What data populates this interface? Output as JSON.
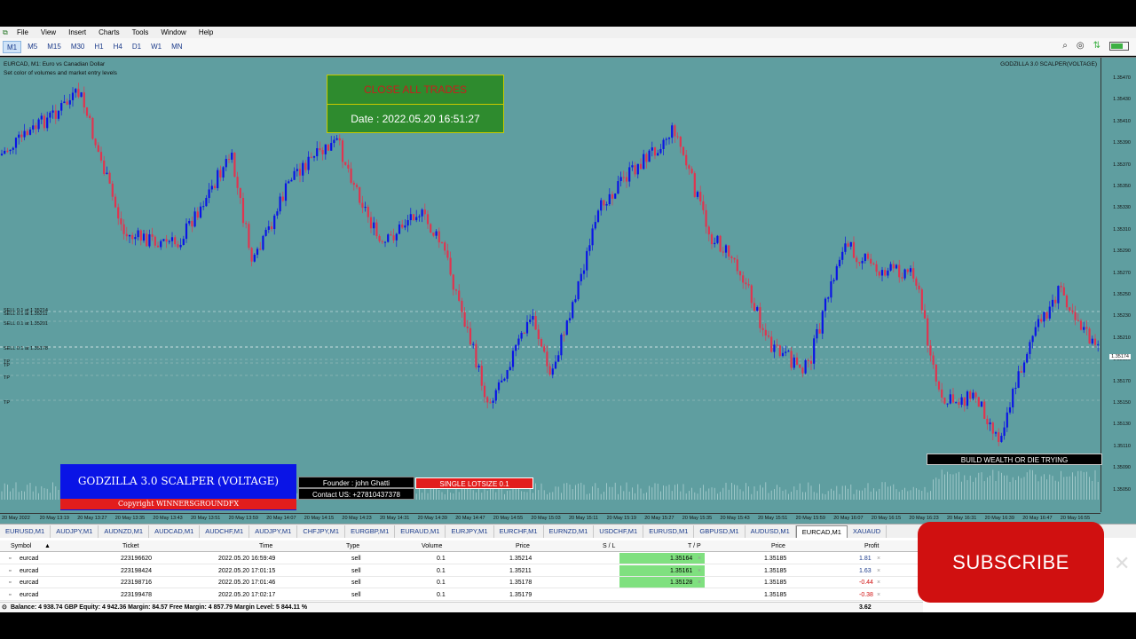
{
  "menu": [
    "File",
    "View",
    "Insert",
    "Charts",
    "Tools",
    "Window",
    "Help"
  ],
  "timeframes": [
    "M1",
    "M5",
    "M15",
    "M30",
    "H1",
    "H4",
    "D1",
    "W1",
    "MN"
  ],
  "active_timeframe": "M1",
  "chart": {
    "header_line1": "EURCAD, M1:  Euro vs Canadian Dollar",
    "header_line2": "Set color of volumes and market entry levels",
    "indicator_name": "GODZILLA 3.0 SCALPER(VOLTAGE)",
    "close_all_label": "CLOSE ALL TRADES",
    "date_label": "Date : 2022.05.20 16:51:27",
    "order_labels": [
      "SELL 0.1 at 1.35214",
      "SELL 0.1 at 1.35211",
      "SELL 0.1 at 1.35201",
      "SELL 0.1 at 1.35178",
      "TP",
      "TP",
      "TP",
      "TP"
    ],
    "brand_title": "GODZILLA 3.0 SCALPER (VOLTAGE)",
    "brand_copy": "Copyright WINNERSGROUNDFX",
    "founder": "Founder : john Ghatti",
    "contact": "Contact US:  +27810437378",
    "lotsize": "SINGLE LOTSIZE 0.1",
    "slogan": "BUILD WEALTH OR DIE TRYING",
    "price_labels": [
      "1.35470",
      "1.35430",
      "1.35410",
      "1.35390",
      "1.35370",
      "1.35350",
      "1.35330",
      "1.35310",
      "1.35290",
      "1.35270",
      "1.35250",
      "1.35230",
      "1.35210",
      "1.35190",
      "1.35170",
      "1.35150",
      "1.35130",
      "1.35110",
      "1.35090",
      "1.35050"
    ],
    "current_price_tag": "1.35174",
    "time_labels": [
      "20 May 2022",
      "20 May 13:19",
      "20 May 13:27",
      "20 May 13:35",
      "20 May 13:43",
      "20 May 13:51",
      "20 May 13:59",
      "20 May 14:07",
      "20 May 14:15",
      "20 May 14:23",
      "20 May 14:31",
      "20 May 14:39",
      "20 May 14:47",
      "20 May 14:55",
      "20 May 15:03",
      "20 May 15:11",
      "20 May 15:19",
      "20 May 15:27",
      "20 May 15:35",
      "20 May 15:43",
      "20 May 15:51",
      "20 May 15:59",
      "20 May 16:07",
      "20 May 16:15",
      "20 May 16:23",
      "20 May 16:31",
      "20 May 16:39",
      "20 May 16:47",
      "20 May 16:55"
    ],
    "colors": {
      "background": "#5f9ea0",
      "bull": "#0a14e6",
      "bear": "#e0344f"
    }
  },
  "symbol_tabs": [
    "EURUSD,M1",
    "AUDJPY,M1",
    "AUDNZD,M1",
    "AUDCAD,M1",
    "AUDCHF,M1",
    "AUDJPY,M1",
    "CHFJPY,M1",
    "EURGBP,M1",
    "EURAUD,M1",
    "EURJPY,M1",
    "EURCHF,M1",
    "EURNZD,M1",
    "USDCHF,M1",
    "EURUSD,M1",
    "GBPUSD,M1",
    "AUDUSD,M1",
    "EURCAD,M1",
    "XAUAUD"
  ],
  "active_symbol_tab": "EURCAD,M1",
  "trades": {
    "headers": [
      "Symbol",
      "Ticket",
      "Time",
      "Type",
      "Volume",
      "Price",
      "S / L",
      "T / P",
      "Price",
      "Profit"
    ],
    "rows": [
      {
        "symbol": "eurcad",
        "ticket": "223196620",
        "time": "2022.05.20 16:59:49",
        "type": "sell",
        "volume": "0.1",
        "price": "1.35214",
        "sl": "",
        "tp": "1.35164",
        "cur": "1.35185",
        "profit": "1.81"
      },
      {
        "symbol": "eurcad",
        "ticket": "223198424",
        "time": "2022.05.20 17:01:15",
        "type": "sell",
        "volume": "0.1",
        "price": "1.35211",
        "sl": "",
        "tp": "1.35161",
        "cur": "1.35185",
        "profit": "1.63"
      },
      {
        "symbol": "eurcad",
        "ticket": "223198716",
        "time": "2022.05.20 17:01:46",
        "type": "sell",
        "volume": "0.1",
        "price": "1.35178",
        "sl": "",
        "tp": "1.35128",
        "cur": "1.35185",
        "profit": "-0.44"
      },
      {
        "symbol": "eurcad",
        "ticket": "223199478",
        "time": "2022.05.20 17:02:17",
        "type": "sell",
        "volume": "0.1",
        "price": "1.35179",
        "sl": "",
        "tp": "",
        "cur": "1.35185",
        "profit": "-0.38"
      }
    ],
    "balance_line": "Balance: 4 938.74 GBP  Equity: 4 942.36  Margin: 84.57  Free Margin: 4 857.79  Margin Level: 5 844.11 %",
    "total_profit": "3.62"
  },
  "subscribe_label": "SUBSCRIBE",
  "battery_level": 0.7
}
